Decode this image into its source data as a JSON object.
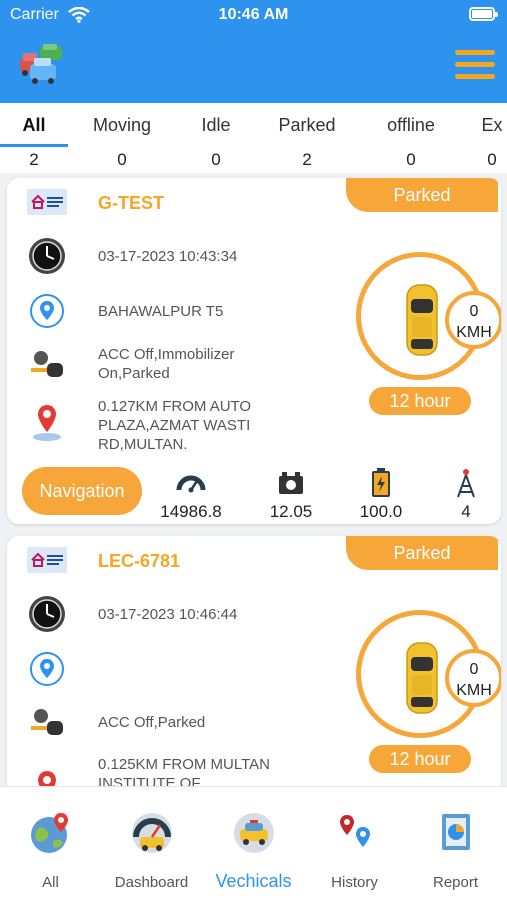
{
  "status_bar": {
    "carrier": "Carrier",
    "time": "10:46 AM"
  },
  "header": {
    "logo_icon": "cars-logo-icon",
    "menu_icon": "hamburger-menu-icon",
    "brand_color": "#2e93ee",
    "accent_color": "#f7a63a"
  },
  "tabs": [
    {
      "label": "All",
      "count": "2",
      "active": true
    },
    {
      "label": "Moving",
      "count": "0"
    },
    {
      "label": "Idle",
      "count": "0"
    },
    {
      "label": "Parked",
      "count": "2"
    },
    {
      "label": "offline",
      "count": "0"
    },
    {
      "label": "Ex",
      "count": "0"
    }
  ],
  "vehicles": [
    {
      "status": "Parked",
      "plate": "G-TEST",
      "datetime": "03-17-2023 10:43:34",
      "city": "BAHAWALPUR T5",
      "acc_status": "ACC Off,Immobilizer On,Parked",
      "distance_info": "0.127KM FROM AUTO PLAZA,AZMAT WASTI RD,MULTAN.",
      "speed_value": "0",
      "speed_unit": "KMH",
      "duration": "12 hour",
      "nav_label": "Navigation",
      "stats": {
        "odometer": "14986.8",
        "voltage": "12.05",
        "battery": "100.0",
        "signal": "4"
      }
    },
    {
      "status": "Parked",
      "plate": "LEC-6781",
      "datetime": "03-17-2023 10:46:44",
      "city": "",
      "acc_status": "ACC Off,Parked",
      "distance_info": "0.125KM FROM MULTAN INSTITUTE OF",
      "speed_value": "0",
      "speed_unit": "KMH",
      "duration": "12 hour"
    }
  ],
  "bottom_nav": [
    {
      "label": "All",
      "icon": "globe-pin-icon"
    },
    {
      "label": "Dashboard",
      "icon": "speedometer-icon"
    },
    {
      "label": "Vechicals",
      "icon": "taxi-icon",
      "active": true
    },
    {
      "label": "History",
      "icon": "map-pins-icon"
    },
    {
      "label": "Report",
      "icon": "report-chart-icon"
    }
  ]
}
